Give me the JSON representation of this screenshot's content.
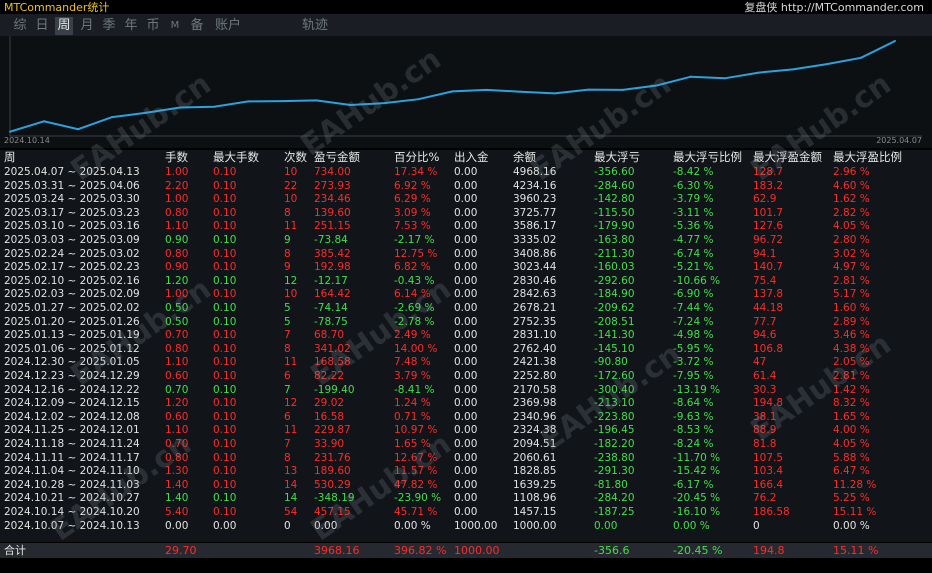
{
  "app": {
    "title": "MTCommander统计",
    "site": "复盘侠 http://MTCommander.com"
  },
  "tabs": [
    "综",
    "日",
    "周",
    "月",
    "季",
    "年",
    "币",
    "M",
    "备",
    "账户",
    "轨迹"
  ],
  "active_tab": 2,
  "chart": {
    "start_label": "2024.10.14",
    "end_label": "2025.04.07",
    "line_color": "#29a3e0"
  },
  "chart_data": {
    "type": "line",
    "x": [
      "2024.10.07",
      "2024.10.14",
      "2024.10.21",
      "2024.10.28",
      "2024.11.04",
      "2024.11.11",
      "2024.11.18",
      "2024.11.25",
      "2024.12.02",
      "2024.12.09",
      "2024.12.16",
      "2024.12.23",
      "2024.12.30",
      "2025.01.06",
      "2025.01.13",
      "2025.01.20",
      "2025.01.27",
      "2025.02.03",
      "2025.02.10",
      "2025.02.17",
      "2025.02.24",
      "2025.03.03",
      "2025.03.10",
      "2025.03.17",
      "2025.03.24",
      "2025.03.31",
      "2025.04.07"
    ],
    "series": [
      {
        "values": [
          1000.0,
          1457.15,
          1108.96,
          1639.25,
          1828.85,
          2060.61,
          2094.51,
          2324.38,
          2340.96,
          2369.98,
          2170.58,
          2252.8,
          2421.38,
          2762.4,
          2831.1,
          2752.35,
          2678.21,
          2842.63,
          2830.46,
          3023.44,
          3408.86,
          3335.02,
          3586.17,
          3725.77,
          3960.23,
          4234.16,
          4968.16
        ]
      }
    ],
    "ylim": [
      900,
      5100
    ]
  },
  "table": {
    "headers": [
      "周",
      "手数",
      "最大手数",
      "次数",
      "盈亏金额",
      "百分比%",
      "出入金",
      "余额",
      "最大浮亏",
      "最大浮亏比例",
      "最大浮盈金额",
      "最大浮盈比例"
    ],
    "rows": [
      [
        "2025.04.07 ~ 2025.04.13",
        "1.00",
        "0.10",
        "10",
        "734.00",
        "17.34 %",
        "0.00",
        "4968.16",
        "-356.60",
        "-8.42 %",
        "128.7",
        "2.96 %"
      ],
      [
        "2025.03.31 ~ 2025.04.06",
        "2.20",
        "0.10",
        "22",
        "273.93",
        "6.92 %",
        "0.00",
        "4234.16",
        "-284.60",
        "-6.30 %",
        "183.2",
        "4.60 %"
      ],
      [
        "2025.03.24 ~ 2025.03.30",
        "1.00",
        "0.10",
        "10",
        "234.46",
        "6.29 %",
        "0.00",
        "3960.23",
        "-142.80",
        "-3.79 %",
        "62.9",
        "1.62 %"
      ],
      [
        "2025.03.17 ~ 2025.03.23",
        "0.80",
        "0.10",
        "8",
        "139.60",
        "3.09 %",
        "0.00",
        "3725.77",
        "-115.50",
        "-3.11 %",
        "101.7",
        "2.82 %"
      ],
      [
        "2025.03.10 ~ 2025.03.16",
        "1.10",
        "0.10",
        "11",
        "251.15",
        "7.53 %",
        "0.00",
        "3586.17",
        "-179.90",
        "-5.36 %",
        "127.6",
        "4.05 %"
      ],
      [
        "2025.03.03 ~ 2025.03.09",
        "0.90",
        "0.10",
        "9",
        "-73.84",
        "-2.17 %",
        "0.00",
        "3335.02",
        "-163.80",
        "-4.77 %",
        "96.72",
        "2.80 %"
      ],
      [
        "2025.02.24 ~ 2025.03.02",
        "0.80",
        "0.10",
        "8",
        "385.42",
        "12.75 %",
        "0.00",
        "3408.86",
        "-211.30",
        "-6.74 %",
        "94.1",
        "3.02 %"
      ],
      [
        "2025.02.17 ~ 2025.02.23",
        "0.90",
        "0.10",
        "9",
        "192.98",
        "6.82 %",
        "0.00",
        "3023.44",
        "-160.03",
        "-5.21 %",
        "140.7",
        "4.97 %"
      ],
      [
        "2025.02.10 ~ 2025.02.16",
        "1.20",
        "0.10",
        "12",
        "-12.17",
        "-0.43 %",
        "0.00",
        "2830.46",
        "-292.60",
        "-10.66 %",
        "75.4",
        "2.81 %"
      ],
      [
        "2025.02.03 ~ 2025.02.09",
        "1.00",
        "0.10",
        "10",
        "164.42",
        "6.14 %",
        "0.00",
        "2842.63",
        "-184.90",
        "-6.90 %",
        "137.8",
        "5.17 %"
      ],
      [
        "2025.01.27 ~ 2025.02.02",
        "0.50",
        "0.10",
        "5",
        "-74.14",
        "-2.69 %",
        "0.00",
        "2678.21",
        "-209.62",
        "-7.44 %",
        "44.18",
        "1.60 %"
      ],
      [
        "2025.01.20 ~ 2025.01.26",
        "0.50",
        "0.10",
        "5",
        "-78.75",
        "-2.78 %",
        "0.00",
        "2752.35",
        "-208.51",
        "-7.24 %",
        "77.7",
        "2.89 %"
      ],
      [
        "2025.01.13 ~ 2025.01.19",
        "0.70",
        "0.10",
        "7",
        "68.70",
        "2.49 %",
        "0.00",
        "2831.10",
        "-141.30",
        "-4.98 %",
        "94.6",
        "3.46 %"
      ],
      [
        "2025.01.06 ~ 2025.01.12",
        "0.80",
        "0.10",
        "8",
        "341.02",
        "14.00 %",
        "0.00",
        "2762.40",
        "-145.10",
        "-5.95 %",
        "106.8",
        "4.38 %"
      ],
      [
        "2024.12.30 ~ 2025.01.05",
        "1.10",
        "0.10",
        "11",
        "168.58",
        "7.48 %",
        "0.00",
        "2421.38",
        "-90.80",
        "-3.72 %",
        "47",
        "2.05 %"
      ],
      [
        "2024.12.23 ~ 2024.12.29",
        "0.60",
        "0.10",
        "6",
        "82.22",
        "3.79 %",
        "0.00",
        "2252.80",
        "-172.60",
        "-7.95 %",
        "61.4",
        "2.81 %"
      ],
      [
        "2024.12.16 ~ 2024.12.22",
        "0.70",
        "0.10",
        "7",
        "-199.40",
        "-8.41 %",
        "0.00",
        "2170.58",
        "-300.40",
        "-13.19 %",
        "30.3",
        "1.42 %"
      ],
      [
        "2024.12.09 ~ 2024.12.15",
        "1.20",
        "0.10",
        "12",
        "29.02",
        "1.24 %",
        "0.00",
        "2369.98",
        "-213.10",
        "-8.64 %",
        "194.8",
        "8.32 %"
      ],
      [
        "2024.12.02 ~ 2024.12.08",
        "0.60",
        "0.10",
        "6",
        "16.58",
        "0.71 %",
        "0.00",
        "2340.96",
        "-223.80",
        "-9.63 %",
        "38.1",
        "1.65 %"
      ],
      [
        "2024.11.25 ~ 2024.12.01",
        "1.10",
        "0.10",
        "11",
        "229.87",
        "10.97 %",
        "0.00",
        "2324.38",
        "-196.45",
        "-8.53 %",
        "88.9",
        "4.00 %"
      ],
      [
        "2024.11.18 ~ 2024.11.24",
        "0.70",
        "0.10",
        "7",
        "33.90",
        "1.65 %",
        "0.00",
        "2094.51",
        "-182.20",
        "-8.24 %",
        "81.8",
        "4.05 %"
      ],
      [
        "2024.11.11 ~ 2024.11.17",
        "0.80",
        "0.10",
        "8",
        "231.76",
        "12.67 %",
        "0.00",
        "2060.61",
        "-238.80",
        "-11.70 %",
        "107.5",
        "5.88 %"
      ],
      [
        "2024.11.04 ~ 2024.11.10",
        "1.30",
        "0.10",
        "13",
        "189.60",
        "11.57 %",
        "0.00",
        "1828.85",
        "-291.30",
        "-15.42 %",
        "103.4",
        "6.47 %"
      ],
      [
        "2024.10.28 ~ 2024.11.03",
        "1.40",
        "0.10",
        "14",
        "530.29",
        "47.82 %",
        "0.00",
        "1639.25",
        "-81.80",
        "-6.17 %",
        "166.4",
        "11.28 %"
      ],
      [
        "2024.10.21 ~ 2024.10.27",
        "1.40",
        "0.10",
        "14",
        "-348.19",
        "-23.90 %",
        "0.00",
        "1108.96",
        "-284.20",
        "-20.45 %",
        "76.2",
        "5.25 %"
      ],
      [
        "2024.10.14 ~ 2024.10.20",
        "5.40",
        "0.10",
        "54",
        "457.15",
        "45.71 %",
        "0.00",
        "1457.15",
        "-187.25",
        "-16.10 %",
        "186.58",
        "15.11 %"
      ],
      [
        "2024.10.07 ~ 2024.10.13",
        "0.00",
        "0.00",
        "0",
        "0.00",
        "0.00 %",
        "1000.00",
        "1000.00",
        "0.00",
        "0.00 %",
        "0",
        "0.00 %"
      ]
    ],
    "total": [
      "合计",
      "29.70",
      "",
      "",
      "3968.16",
      "396.82 %",
      "1000.00",
      "",
      "-356.6",
      "-20.45 %",
      "194.8",
      "15.11 %"
    ]
  },
  "watermark": "EAHub.cn",
  "colors": {
    "profit": "#ff2a2a",
    "loss": "#3fe04a",
    "text": "#e2e2e2"
  }
}
